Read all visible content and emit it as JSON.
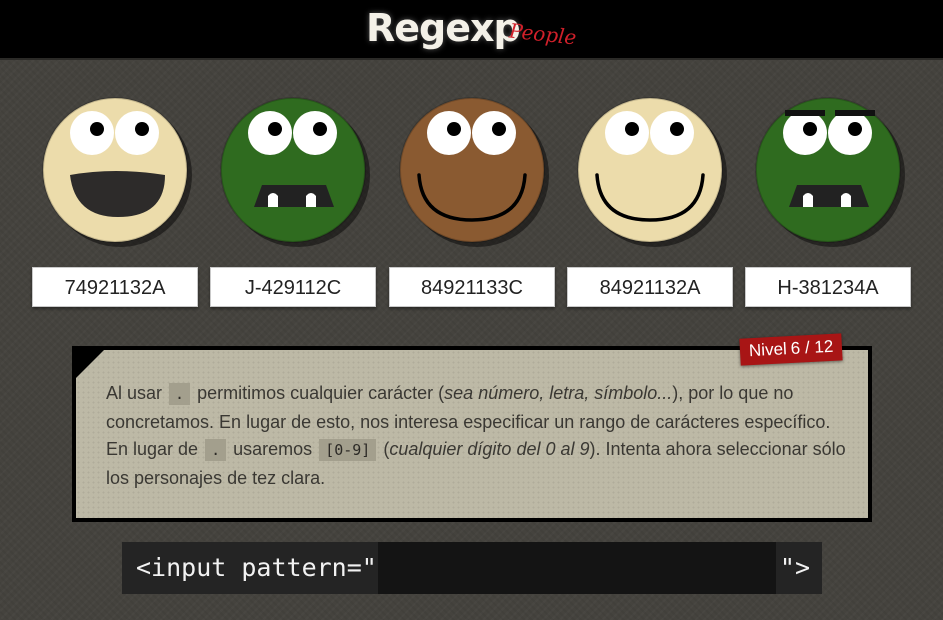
{
  "header": {
    "logo_main": "Regexp",
    "logo_sub": "People"
  },
  "faces": [
    {
      "label": "74921132A",
      "skin": "#ecdcab",
      "expression": "laugh"
    },
    {
      "label": "J-429112C",
      "skin": "#2f6b1f",
      "expression": "monster"
    },
    {
      "label": "84921133C",
      "skin": "#8a5a31",
      "expression": "smile"
    },
    {
      "label": "84921132A",
      "skin": "#ecdcab",
      "expression": "smile"
    },
    {
      "label": "H-381234A",
      "skin": "#2f6b1f",
      "expression": "monster-brows"
    }
  ],
  "lesson": {
    "level_label": "Nivel",
    "level_value": "6 / 12",
    "t1": "Al usar",
    "c1": ".",
    "t2": "permitimos cualquier carácter (",
    "i1": "sea número, letra, símbolo...",
    "t3": "), por lo que no concretamos. En lugar de esto, nos interesa especificar un rango de carácteres específico. En lugar de",
    "c2": ".",
    "t4": "usaremos",
    "c3": "[0-9]",
    "t5": "(",
    "i2": "cualquier dígito del 0 al 9",
    "t6": "). Intenta ahora seleccionar sólo los personajes de tez clara."
  },
  "input": {
    "prefix": "<input pattern=\"",
    "suffix": "\">",
    "value": ""
  },
  "colors": {
    "background": "#45433e",
    "panel": "#bdb9a6",
    "badge": "#a81515",
    "logo_accent": "#d0202a"
  }
}
